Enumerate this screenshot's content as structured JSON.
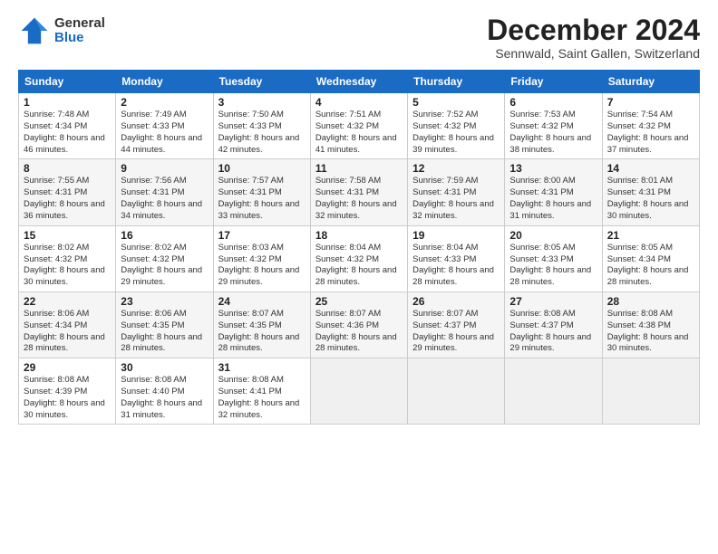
{
  "logo": {
    "general": "General",
    "blue": "Blue"
  },
  "title": "December 2024",
  "location": "Sennwald, Saint Gallen, Switzerland",
  "days_of_week": [
    "Sunday",
    "Monday",
    "Tuesday",
    "Wednesday",
    "Thursday",
    "Friday",
    "Saturday"
  ],
  "weeks": [
    [
      {
        "day": "1",
        "sunrise": "7:48 AM",
        "sunset": "4:34 PM",
        "daylight": "8 hours and 46 minutes."
      },
      {
        "day": "2",
        "sunrise": "7:49 AM",
        "sunset": "4:33 PM",
        "daylight": "8 hours and 44 minutes."
      },
      {
        "day": "3",
        "sunrise": "7:50 AM",
        "sunset": "4:33 PM",
        "daylight": "8 hours and 42 minutes."
      },
      {
        "day": "4",
        "sunrise": "7:51 AM",
        "sunset": "4:32 PM",
        "daylight": "8 hours and 41 minutes."
      },
      {
        "day": "5",
        "sunrise": "7:52 AM",
        "sunset": "4:32 PM",
        "daylight": "8 hours and 39 minutes."
      },
      {
        "day": "6",
        "sunrise": "7:53 AM",
        "sunset": "4:32 PM",
        "daylight": "8 hours and 38 minutes."
      },
      {
        "day": "7",
        "sunrise": "7:54 AM",
        "sunset": "4:32 PM",
        "daylight": "8 hours and 37 minutes."
      }
    ],
    [
      {
        "day": "8",
        "sunrise": "7:55 AM",
        "sunset": "4:31 PM",
        "daylight": "8 hours and 36 minutes."
      },
      {
        "day": "9",
        "sunrise": "7:56 AM",
        "sunset": "4:31 PM",
        "daylight": "8 hours and 34 minutes."
      },
      {
        "day": "10",
        "sunrise": "7:57 AM",
        "sunset": "4:31 PM",
        "daylight": "8 hours and 33 minutes."
      },
      {
        "day": "11",
        "sunrise": "7:58 AM",
        "sunset": "4:31 PM",
        "daylight": "8 hours and 32 minutes."
      },
      {
        "day": "12",
        "sunrise": "7:59 AM",
        "sunset": "4:31 PM",
        "daylight": "8 hours and 32 minutes."
      },
      {
        "day": "13",
        "sunrise": "8:00 AM",
        "sunset": "4:31 PM",
        "daylight": "8 hours and 31 minutes."
      },
      {
        "day": "14",
        "sunrise": "8:01 AM",
        "sunset": "4:31 PM",
        "daylight": "8 hours and 30 minutes."
      }
    ],
    [
      {
        "day": "15",
        "sunrise": "8:02 AM",
        "sunset": "4:32 PM",
        "daylight": "8 hours and 30 minutes."
      },
      {
        "day": "16",
        "sunrise": "8:02 AM",
        "sunset": "4:32 PM",
        "daylight": "8 hours and 29 minutes."
      },
      {
        "day": "17",
        "sunrise": "8:03 AM",
        "sunset": "4:32 PM",
        "daylight": "8 hours and 29 minutes."
      },
      {
        "day": "18",
        "sunrise": "8:04 AM",
        "sunset": "4:32 PM",
        "daylight": "8 hours and 28 minutes."
      },
      {
        "day": "19",
        "sunrise": "8:04 AM",
        "sunset": "4:33 PM",
        "daylight": "8 hours and 28 minutes."
      },
      {
        "day": "20",
        "sunrise": "8:05 AM",
        "sunset": "4:33 PM",
        "daylight": "8 hours and 28 minutes."
      },
      {
        "day": "21",
        "sunrise": "8:05 AM",
        "sunset": "4:34 PM",
        "daylight": "8 hours and 28 minutes."
      }
    ],
    [
      {
        "day": "22",
        "sunrise": "8:06 AM",
        "sunset": "4:34 PM",
        "daylight": "8 hours and 28 minutes."
      },
      {
        "day": "23",
        "sunrise": "8:06 AM",
        "sunset": "4:35 PM",
        "daylight": "8 hours and 28 minutes."
      },
      {
        "day": "24",
        "sunrise": "8:07 AM",
        "sunset": "4:35 PM",
        "daylight": "8 hours and 28 minutes."
      },
      {
        "day": "25",
        "sunrise": "8:07 AM",
        "sunset": "4:36 PM",
        "daylight": "8 hours and 28 minutes."
      },
      {
        "day": "26",
        "sunrise": "8:07 AM",
        "sunset": "4:37 PM",
        "daylight": "8 hours and 29 minutes."
      },
      {
        "day": "27",
        "sunrise": "8:08 AM",
        "sunset": "4:37 PM",
        "daylight": "8 hours and 29 minutes."
      },
      {
        "day": "28",
        "sunrise": "8:08 AM",
        "sunset": "4:38 PM",
        "daylight": "8 hours and 30 minutes."
      }
    ],
    [
      {
        "day": "29",
        "sunrise": "8:08 AM",
        "sunset": "4:39 PM",
        "daylight": "8 hours and 30 minutes."
      },
      {
        "day": "30",
        "sunrise": "8:08 AM",
        "sunset": "4:40 PM",
        "daylight": "8 hours and 31 minutes."
      },
      {
        "day": "31",
        "sunrise": "8:08 AM",
        "sunset": "4:41 PM",
        "daylight": "8 hours and 32 minutes."
      },
      null,
      null,
      null,
      null
    ]
  ]
}
